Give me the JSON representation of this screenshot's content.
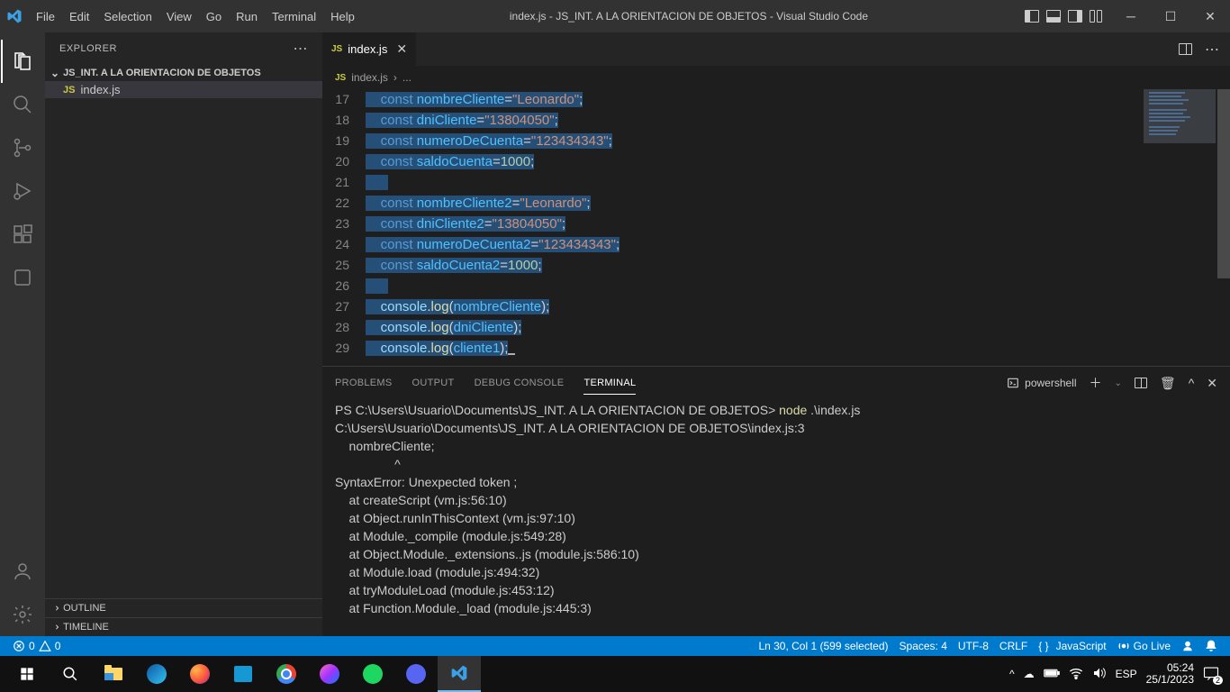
{
  "menu": [
    "File",
    "Edit",
    "Selection",
    "View",
    "Go",
    "Run",
    "Terminal",
    "Help"
  ],
  "windowTitle": "index.js - JS_INT. A LA ORIENTACION DE OBJETOS - Visual Studio Code",
  "explorer": {
    "title": "EXPLORER",
    "project": "JS_INT. A LA ORIENTACION DE OBJETOS",
    "file": "index.js",
    "outline": "OUTLINE",
    "timeline": "TIMELINE"
  },
  "tab": {
    "name": "index.js"
  },
  "breadcrumb": {
    "file": "index.js",
    "more": "..."
  },
  "code": {
    "17": {
      "kw": "const",
      "sp": " ",
      "var": "nombreCliente",
      "eq": "=",
      "str": "\"Leonardo\"",
      "end": ";"
    },
    "18": {
      "kw": "const",
      "sp": " ",
      "var": "dniCliente",
      "eq": "=",
      "str": "\"13804050\"",
      "end": ";"
    },
    "19": {
      "kw": "const",
      "sp": " ",
      "var": "numeroDeCuenta",
      "eq": "=",
      "str": "\"123434343\"",
      "end": ";"
    },
    "20": {
      "kw": "const",
      "sp": " ",
      "var": "saldoCuenta",
      "eq": "=",
      "num": "1000",
      "end": ";"
    },
    "21": "",
    "22": {
      "kw": "const",
      "sp": " ",
      "var": "nombreCliente2",
      "eq": "=",
      "str": "\"Leonardo\"",
      "end": ";"
    },
    "23": {
      "kw": "const",
      "sp": " ",
      "var": "dniCliente2",
      "eq": "=",
      "str": "\"13804050\"",
      "end": ";"
    },
    "24": {
      "kw": "const",
      "sp": " ",
      "var": "numeroDeCuenta2",
      "eq": "=",
      "str": "\"123434343\"",
      "end": ";"
    },
    "25": {
      "kw": "const",
      "sp": " ",
      "var": "saldoCuenta2",
      "eq": "=",
      "num": "1000",
      "end": ";"
    },
    "26": "",
    "27": {
      "obj": "console",
      "dot": ".",
      "fn": "log",
      "open": "(",
      "arg": "nombreCliente",
      "close": ")",
      "end": ";"
    },
    "28": {
      "obj": "console",
      "dot": ".",
      "fn": "log",
      "open": "(",
      "arg": "dniCliente",
      "close": ")",
      "end": ";"
    },
    "29": {
      "obj": "console",
      "dot": ".",
      "fn": "log",
      "open": "(",
      "arg": "cliente1",
      "close": ")",
      "end": ";"
    }
  },
  "panelTabs": {
    "problems": "PROBLEMS",
    "output": "OUTPUT",
    "debug": "DEBUG CONSOLE",
    "terminal": "TERMINAL"
  },
  "shell": "powershell",
  "terminal": {
    "l1a": "PS C:\\Users\\Usuario\\Documents\\JS_INT. A LA ORIENTACION DE OBJETOS> ",
    "l1b": "node",
    "l1c": " .\\index.js",
    "l2": "C:\\Users\\Usuario\\Documents\\JS_INT. A LA ORIENTACION DE OBJETOS\\index.js:3",
    "l3": "    nombreCliente;",
    "l4": "                 ^",
    "l5": "",
    "l6": "SyntaxError: Unexpected token ;",
    "l7": "    at createScript (vm.js:56:10)",
    "l8": "    at Object.runInThisContext (vm.js:97:10)",
    "l9": "    at Module._compile (module.js:549:28)",
    "l10": "    at Object.Module._extensions..js (module.js:586:10)",
    "l11": "    at Module.load (module.js:494:32)",
    "l12": "    at tryModuleLoad (module.js:453:12)",
    "l13": "    at Function.Module._load (module.js:445:3)"
  },
  "status": {
    "errors": "0",
    "warnings": "0",
    "position": "Ln 30, Col 1 (599 selected)",
    "spaces": "Spaces: 4",
    "encoding": "UTF-8",
    "eol": "CRLF",
    "lang": "JavaScript",
    "golive": "Go Live"
  },
  "tray": {
    "lang": "ESP",
    "time": "05:24",
    "date": "25/1/2023",
    "notif": "2"
  }
}
